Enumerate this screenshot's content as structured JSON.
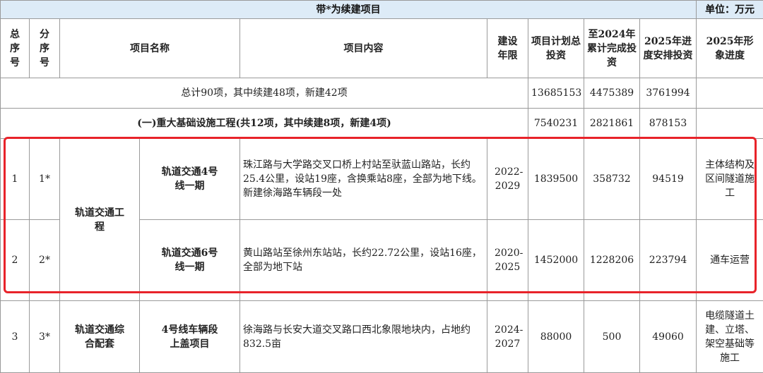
{
  "header": {
    "title": "带*为续建项目",
    "unit": "单位：万元",
    "cols": {
      "total_no": "总序号",
      "sub_no": "分序号",
      "name": "项目名称",
      "content": "项目内容",
      "period": "建设年限",
      "plan": "项目计划总投资",
      "cumulative": "至2024年累计完成投资",
      "arranged": "2025年进度安排投资",
      "progress": "2025年形象进度"
    }
  },
  "summary": {
    "label": "总计90项，其中续建48项，新建42项",
    "plan": "13685153",
    "cumulative": "4475389",
    "arranged": "3761994"
  },
  "section1": {
    "label": "(一)重大基础设施工程(共12项，其中续建8项，新建4项)",
    "plan": "7540231",
    "cumulative": "2821861",
    "arranged": "878153"
  },
  "group1": "轨道交通工程",
  "rows": [
    {
      "no": "1",
      "sub": "1*",
      "name": "轨道交通4号线一期",
      "content": "珠江路与大学路交叉口桥上村站至驮蓝山路站，长约25.4公里，设站19座，含换乘站8座，全部为地下线。新建徐海路车辆段一处",
      "period": "2022-2029",
      "plan": "1839500",
      "cumulative": "358732",
      "arranged": "94519",
      "progress": "主体结构及区间隧道施工"
    },
    {
      "no": "2",
      "sub": "2*",
      "name": "轨道交通6号线一期",
      "content": "黄山路站至徐州东站站，长约22.72公里，设站16座，全部为地下站",
      "period": "2020-2025",
      "plan": "1452000",
      "cumulative": "1228206",
      "arranged": "223794",
      "progress": "通车运营"
    },
    {
      "no": "3",
      "sub": "3*",
      "group": "轨道交通综合配套",
      "name": "4号线车辆段上盖项目",
      "content": "徐海路与长安大道交叉路口西北象限地块内，占地约832.5亩",
      "period": "2024-2027",
      "plan": "88000",
      "cumulative": "500",
      "arranged": "49060",
      "progress": "电缆隧道土建、立塔、架空基础等施工"
    }
  ]
}
